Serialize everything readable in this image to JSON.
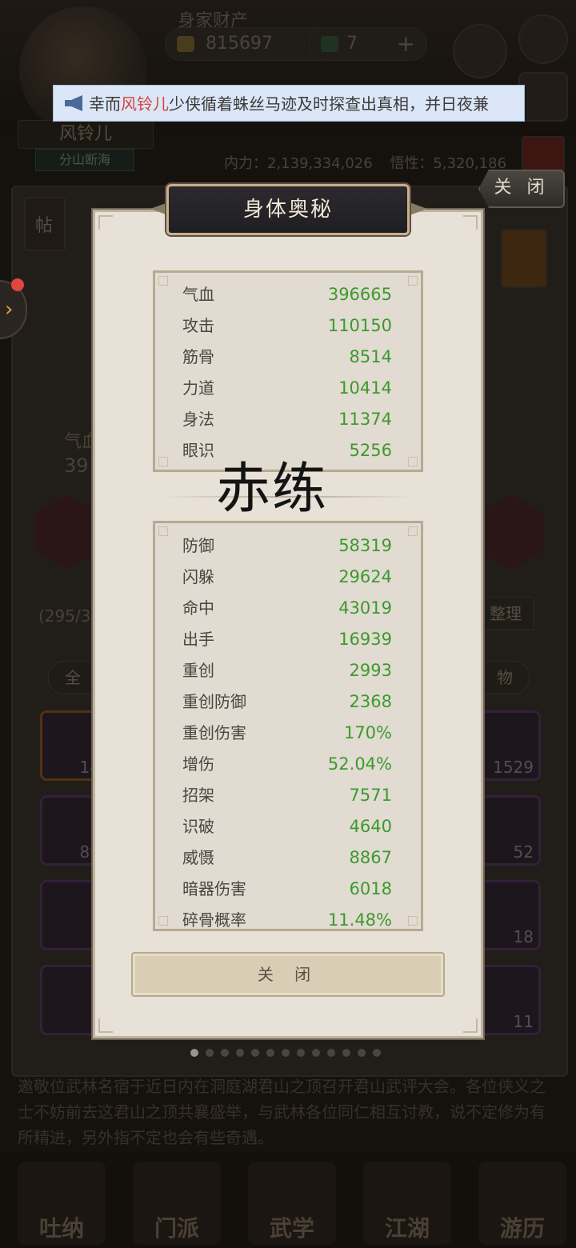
{
  "background": {
    "title_blur": "身家财产",
    "currency_value": "815697",
    "gem_value": "7",
    "player_name": "风铃儿",
    "player_subtitle": "分山断海",
    "power_label": "内力：2,139,334,026",
    "insight_label": "悟性：5,320,186",
    "left_count": "(295/3",
    "organize": "整理",
    "tab_all": "全",
    "tab_items": "物",
    "tile_counts": [
      "14",
      "89",
      "1529",
      "52",
      "18",
      "11"
    ],
    "hp_label": "气血",
    "hp_short": "39",
    "news": "邀敬位武林名宿于近日内在洞庭湖君山之顶召开君山武评大会。各位侠义之士不妨前去这君山之顶共襄盛举，与武林各位同仁相互讨教，说不定修为有所精进，另外指不定也会有些奇遇。",
    "nav": [
      "吐纳",
      "门派",
      "武学",
      "江湖",
      "游历"
    ],
    "post_label": "帖"
  },
  "marquee": {
    "prefix": "幸而",
    "highlight": "风铃儿",
    "suffix": "少侠循着蛛丝马迹及时探查出真相，并日夜兼"
  },
  "top_close": "关 闭",
  "dialog": {
    "title": "身体奥秘",
    "overlay_text": "赤练",
    "close_label": "关 闭",
    "basic_stats": [
      {
        "label": "气血",
        "value": "396665"
      },
      {
        "label": "攻击",
        "value": "110150"
      },
      {
        "label": "筋骨",
        "value": "8514"
      },
      {
        "label": "力道",
        "value": "10414"
      },
      {
        "label": "身法",
        "value": "11374"
      },
      {
        "label": "眼识",
        "value": "5256"
      }
    ],
    "combat_stats": [
      {
        "label": "防御",
        "value": "58319"
      },
      {
        "label": "闪躲",
        "value": "29624"
      },
      {
        "label": "命中",
        "value": "43019"
      },
      {
        "label": "出手",
        "value": "16939"
      },
      {
        "label": "重创",
        "value": "2993"
      },
      {
        "label": "重创防御",
        "value": "2368"
      },
      {
        "label": "重创伤害",
        "value": "170%"
      },
      {
        "label": "增伤",
        "value": "52.04%"
      },
      {
        "label": "招架",
        "value": "7571"
      },
      {
        "label": "识破",
        "value": "4640"
      },
      {
        "label": "威慑",
        "value": "8867"
      },
      {
        "label": "暗器伤害",
        "value": "6018"
      },
      {
        "label": "碎骨概率",
        "value": "11.48%"
      }
    ],
    "page_count": 13,
    "active_page": 0
  },
  "colors": {
    "stat_value": "#3c9a2c",
    "marquee_highlight": "#d7423a",
    "dialog_bg": "#e7e1d8"
  }
}
